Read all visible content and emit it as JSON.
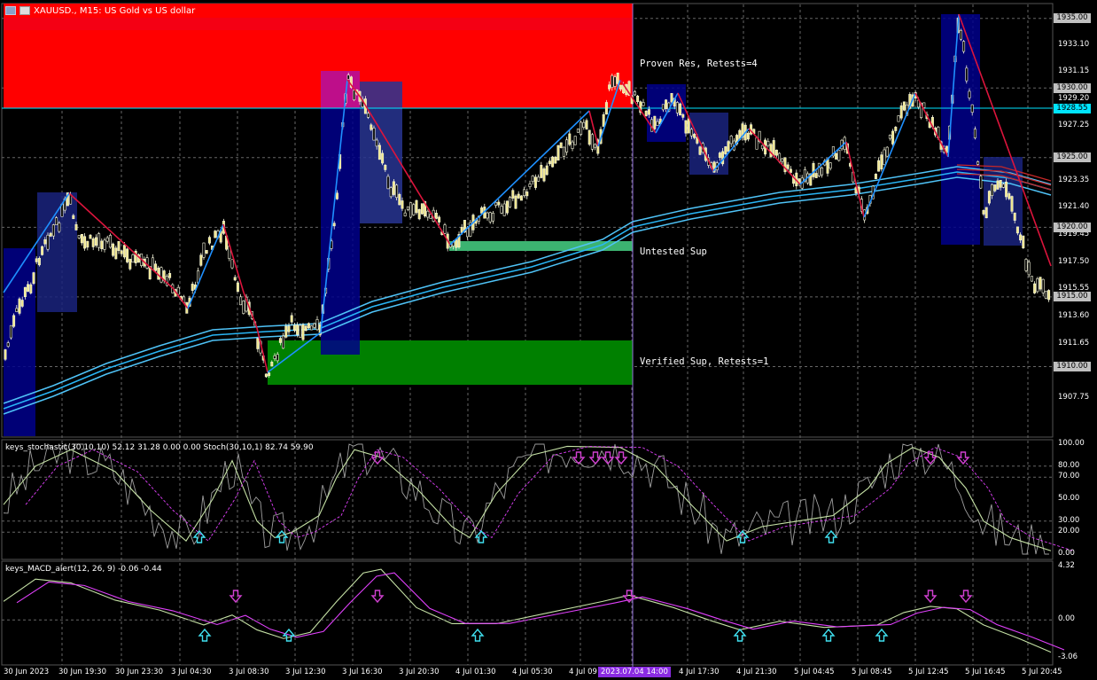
{
  "header": {
    "symbol_title": "XAUUSD., M15: US Gold vs US dollar",
    "stoch_title": "keys_stochastic(30,10,10) 52.12 31.28 0.00 0.00 Stoch(30,10,1) 82.74 59.90",
    "macd_title": "keys_MACD_alert(12, 26, 9) -0.06 -0.44"
  },
  "zones": {
    "resistance": "Proven Res, Retests=4",
    "untested": "Untested Sup",
    "verified": "Verified Sup, Retests=1"
  },
  "price_axis": {
    "labels": [
      {
        "v": "1933.10",
        "p": 1933.1
      },
      {
        "v": "1931.15",
        "p": 1931.15
      },
      {
        "v": "1929.20",
        "p": 1929.2
      },
      {
        "v": "1927.25",
        "p": 1927.25
      },
      {
        "v": "1923.35",
        "p": 1923.35
      },
      {
        "v": "1921.40",
        "p": 1921.4
      },
      {
        "v": "1919.45",
        "p": 1919.45
      },
      {
        "v": "1917.50",
        "p": 1917.5
      },
      {
        "v": "1915.55",
        "p": 1915.55
      },
      {
        "v": "1913.60",
        "p": 1913.6
      },
      {
        "v": "1911.65",
        "p": 1911.65
      },
      {
        "v": "1907.75",
        "p": 1907.75
      }
    ],
    "boxes": [
      {
        "v": "1935.00",
        "p": 1935.0
      },
      {
        "v": "1930.00",
        "p": 1930.0
      },
      {
        "v": "1928.55",
        "p": 1928.55
      },
      {
        "v": "1925.00",
        "p": 1925.0
      },
      {
        "v": "1920.00",
        "p": 1920.0
      },
      {
        "v": "1915.00",
        "p": 1915.0
      },
      {
        "v": "1910.00",
        "p": 1910.0
      }
    ],
    "range": [
      1905.0,
      1935.8
    ]
  },
  "stoch_axis": [
    "100.00",
    "80.00",
    "70.00",
    "50.00",
    "30.00",
    "20.00",
    "0.00"
  ],
  "macd_axis": [
    "4.32",
    "0.00",
    "-3.06"
  ],
  "time_axis": [
    "30 Jun 2023",
    "30 Jun 19:30",
    "30 Jun 23:30",
    "3 Jul 04:30",
    "3 Jul 08:30",
    "3 Jul 12:30",
    "3 Jul 16:30",
    "3 Jul 20:30",
    "4 Jul 01:30",
    "4 Jul 05:30",
    "4 Jul 09",
    "4 Jul 17:30",
    "4 Jul 21:30",
    "5 Jul 04:45",
    "5 Jul 08:45",
    "5 Jul 12:45",
    "5 Jul 16:45",
    "5 Jul 20:45"
  ],
  "time_cursor": "2023.07.04 14:00",
  "colors": {
    "resistance": "#ff0000",
    "verified": "#008000",
    "untested": "#3cb371",
    "zigzag_up": "#1e90ff",
    "zigzag_down": "#dc143c",
    "ma": "#4fc3f7",
    "cursor": "#9370db",
    "arrow_up": "#40e0f0",
    "arrow_down": "#d040d0",
    "candle_panel": "#000080"
  }
}
